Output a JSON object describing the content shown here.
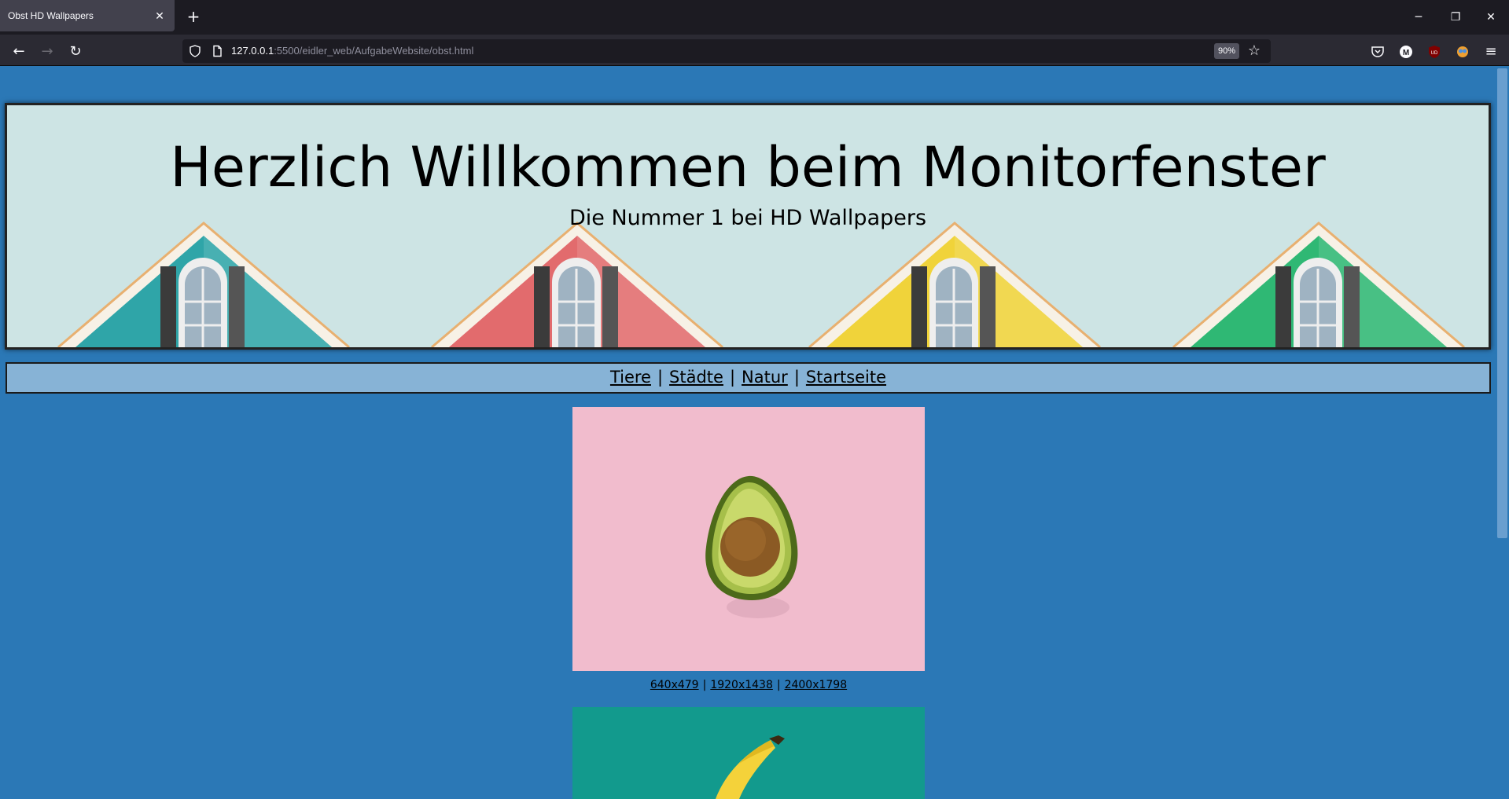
{
  "browser": {
    "tab_title": "Obst HD Wallpapers",
    "url_host": "127.0.0.1",
    "url_path": ":5500/eidler_web/AufgabeWebsite/obst.html",
    "zoom": "90%",
    "extensions": [
      "pocket-icon",
      "m-extension-icon",
      "ublock-icon",
      "color-extension-icon"
    ]
  },
  "header": {
    "title": "Herzlich Willkommen beim Monitorfenster",
    "subtitle": "Die Nummer 1 bei HD Wallpapers",
    "house_colors": [
      "#2fa5a8",
      "#e26b6d",
      "#f0d33a",
      "#2fb874"
    ]
  },
  "menu": {
    "items": [
      "Tiere",
      "Städte",
      "Natur",
      "Startseite"
    ],
    "separator": "|"
  },
  "gallery": [
    {
      "subject": "avocado",
      "background": "#f1bccd",
      "resolutions": [
        "640x479",
        "1920x1438",
        "2400x1798"
      ]
    },
    {
      "subject": "banana",
      "background": "#129a8d",
      "resolutions": []
    }
  ]
}
